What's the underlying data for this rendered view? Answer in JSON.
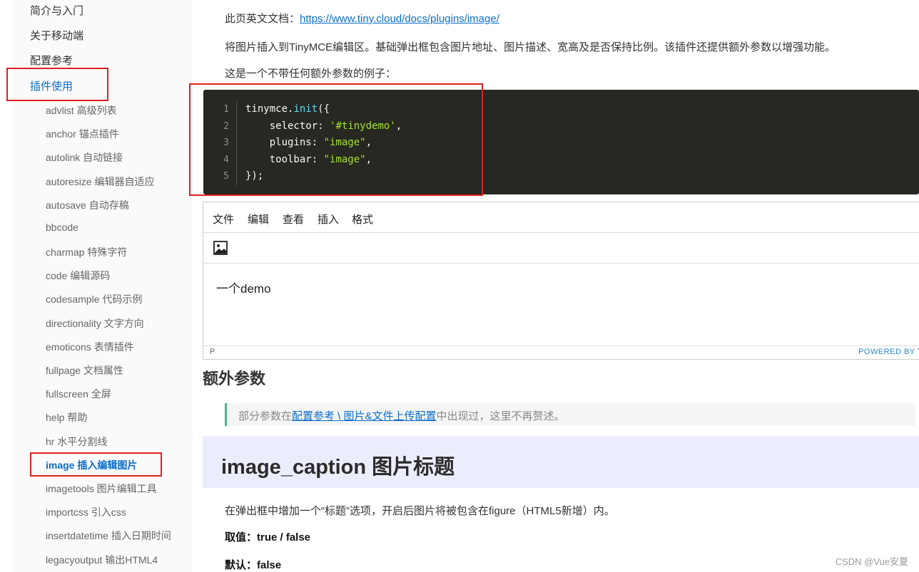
{
  "sidebar": {
    "top_items": [
      "简介与入门",
      "关于移动端",
      "配置参考",
      "插件使用"
    ],
    "sub_items": [
      "advlist 高级列表",
      "anchor 锚点插件",
      "autolink 自动链接",
      "autoresize 编辑器自适应",
      "autosave 自动存稿",
      "bbcode",
      "charmap 特殊字符",
      "code 编辑源码",
      "codesample 代码示例",
      "directionality 文字方向",
      "emoticons 表情插件",
      "fullpage 文档属性",
      "fullscreen 全屏",
      "help 帮助",
      "hr 水平分割线",
      "image 插入编辑图片",
      "imagetools 图片编辑工具",
      "importcss 引入css",
      "insertdatetime 插入日期时间",
      "legacyoutput 输出HTML4"
    ]
  },
  "main": {
    "doc_label": "此页英文文档：",
    "doc_url": "https://www.tiny.cloud/docs/plugins/image/",
    "intro": "将图片插入到TinyMCE编辑区。基础弹出框包含图片地址、图片描述、宽高及是否保持比例。该插件还提供额外参数以增强功能。",
    "example_intro": "这是一个不带任何额外参数的例子：",
    "code": {
      "line_numbers": [
        "1",
        "2",
        "3",
        "4",
        "5"
      ],
      "l1_obj": "tinymce.",
      "l1_fn": "init",
      "l1_end": "({",
      "l2_key": "    selector: ",
      "l2_val": "'#tinydemo'",
      "l2_end": ",",
      "l3_key": "    plugins: ",
      "l3_val": "\"image\"",
      "l3_end": ",",
      "l4_key": "    toolbar: ",
      "l4_val": "\"image\"",
      "l4_end": ",",
      "l5": "});"
    },
    "editor": {
      "menus": [
        "文件",
        "编辑",
        "查看",
        "插入",
        "格式"
      ],
      "toolbar_icon": "image-icon",
      "content": "一个demo",
      "path": "P",
      "powered": "POWERED BY T"
    },
    "section_heading": "额外参数",
    "quote": {
      "before": "部分参数在",
      "link": "配置参考 \\ 图片&文件上传配置",
      "after": "中出现过，这里不再赘述。"
    },
    "h3": "image_caption 图片标题",
    "caption_desc": "在弹出框中增加一个“标题”选项，开启后图片将被包含在figure（HTML5新增）内。",
    "values_label": "取值：true / false",
    "default_label": "默认：false"
  },
  "watermark": "CSDN @Vue安夏",
  "colors": {
    "link": "#0b6ec8",
    "annotation": "#e02020",
    "code_bg": "#272822"
  }
}
